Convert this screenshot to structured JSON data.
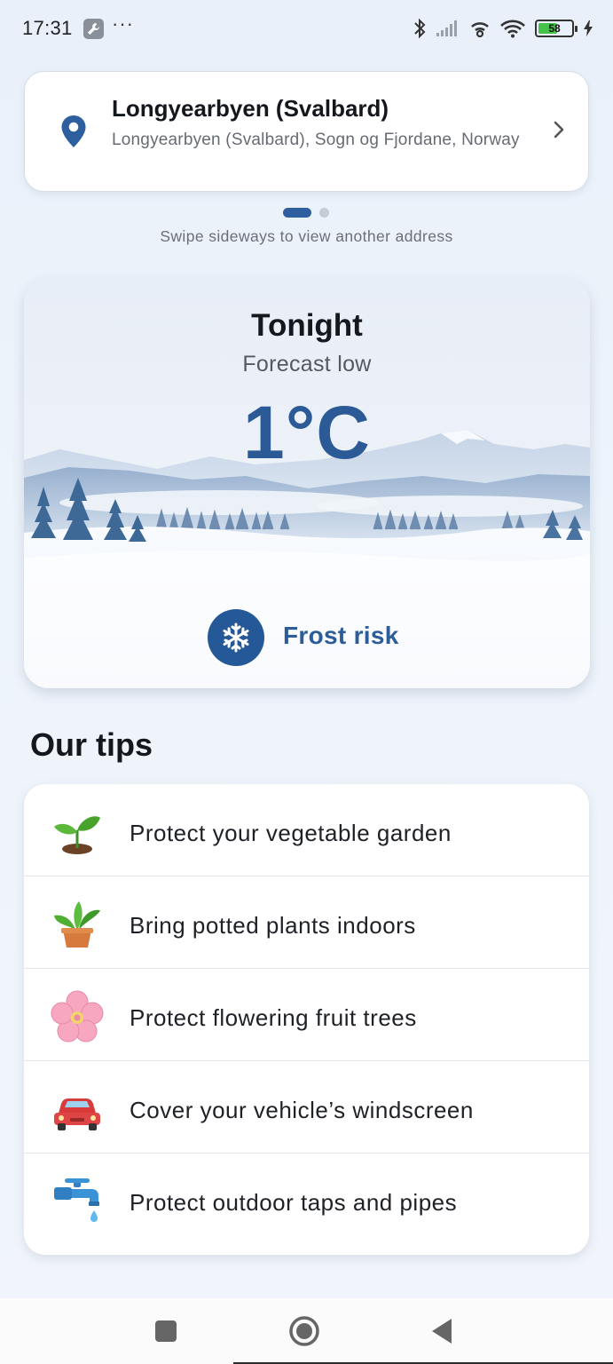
{
  "status_bar": {
    "time": "17:31",
    "more": "···",
    "battery_level": "58",
    "battery_fraction": 0.58
  },
  "location": {
    "name": "Longyearbyen (Svalbard)",
    "detail": "Longyearbyen (Svalbard), Sogn og Fjordane, Norway",
    "swipe_hint": "Swipe sideways to view another address",
    "page_count": 2,
    "active_page": 1
  },
  "forecast": {
    "title": "Tonight",
    "subtitle": "Forecast low",
    "temperature": "1°C",
    "risk_label": "Frost risk",
    "risk_icon": "snowflake-icon",
    "accent_color": "#2b5a97"
  },
  "tips": {
    "heading": "Our tips",
    "items": [
      {
        "icon": "seedling-icon",
        "label": "Protect your vegetable garden"
      },
      {
        "icon": "potted-plant-icon",
        "label": "Bring potted plants indoors"
      },
      {
        "icon": "cherry-blossom-icon",
        "label": "Protect flowering fruit trees"
      },
      {
        "icon": "car-icon",
        "label": "Cover your vehicle’s windscreen"
      },
      {
        "icon": "water-tap-icon",
        "label": "Protect outdoor taps and pipes"
      }
    ]
  },
  "nav_bar": {
    "buttons": [
      "recents-button",
      "home-button",
      "back-button"
    ]
  }
}
